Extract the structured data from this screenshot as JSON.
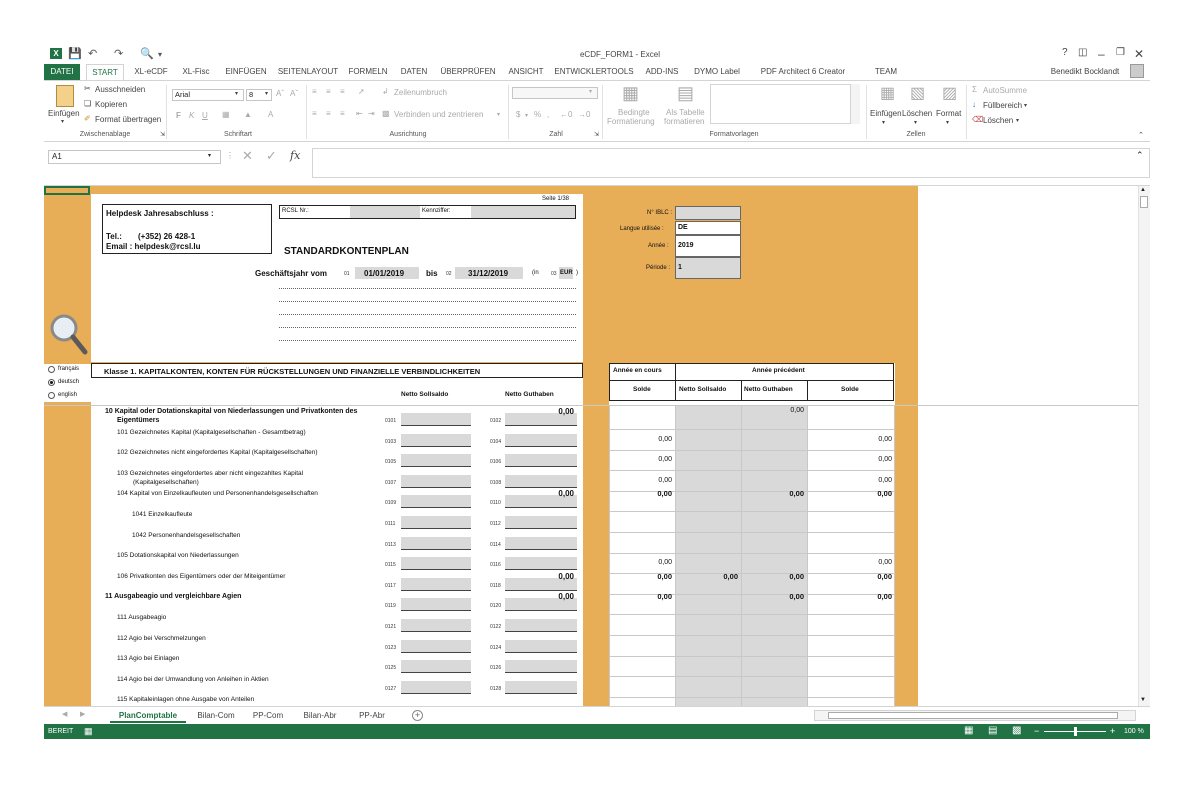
{
  "window": {
    "title": "eCDF_FORM1 - Excel",
    "user": "Benedikt Bocklandt",
    "help": "?",
    "colors": {
      "accent": "#217346",
      "sheet_bg": "#e8ad57"
    }
  },
  "ribbon_tabs": [
    "DATEI",
    "START",
    "XL-eCDF",
    "XL-Fisc",
    "EINFÜGEN",
    "SEITENLAYOUT",
    "FORMELN",
    "DATEN",
    "ÜBERPRÜFEN",
    "ANSICHT",
    "ENTWICKLERTOOLS",
    "ADD-INS",
    "DYMO Label",
    "PDF Architect 6 Creator",
    "TEAM"
  ],
  "ribbon": {
    "clipboard": {
      "paste": "Einfügen",
      "cut": "Ausschneiden",
      "copy": "Kopieren",
      "format_painter": "Format übertragen",
      "label": "Zwischenablage"
    },
    "font": {
      "name": "Arial",
      "size": "8",
      "bold": "F",
      "italic": "K",
      "underline": "U",
      "label": "Schriftart"
    },
    "alignment": {
      "wrap": "Zeilenumbruch",
      "merge": "Verbinden und zentrieren",
      "label": "Ausrichtung"
    },
    "number": {
      "currency": "$",
      "percent": "%",
      "label": "Zahl"
    },
    "styles": {
      "conditional_1": "Bedingte",
      "conditional_2": "Formatierung",
      "as_table_1": "Als Tabelle",
      "as_table_2": "formatieren",
      "label": "Formatvorlagen"
    },
    "cells": {
      "insert": "Einfügen",
      "delete": "Löschen",
      "format": "Format",
      "label": "Zellen"
    },
    "editing": {
      "autosum": "AutoSumme",
      "fill": "Füllbereich",
      "clear": "Löschen"
    }
  },
  "formula_bar": {
    "name_box": "A1",
    "fx": "fx"
  },
  "form": {
    "page": "Seite 1/38",
    "helpdesk_title": "Helpdesk Jahresabschluss :",
    "tel_label": "Tel.:",
    "tel": "(+352) 26 428-1",
    "email": "Email : helpdesk@rcsl.lu",
    "rcsl_label": "RCSL Nr.:",
    "kenn_label": "Kennziffer:",
    "title": "STANDARDKONTENPLAN",
    "fy_label": "Geschäftsjahr vom",
    "code_01": "01",
    "date_from": "01/01/2019",
    "bis": "bis",
    "code_02": "02",
    "date_to": "31/12/2019",
    "in": "(in",
    "code_03": "03",
    "currency": "EUR",
    "close_paren": ")",
    "iblc_label": "N° IBLC :",
    "lang_label": "Langue utilisée :",
    "lang": "DE",
    "year_label": "Année :",
    "year": "2019",
    "period_label": "Période :",
    "period": "1",
    "languages": [
      "français",
      "deutsch",
      "english"
    ],
    "selected_language": "deutsch",
    "class_title": "Klasse 1. KAPITALKONTEN, KONTEN FÜR RÜCKSTELLUNGEN UND FINANZIELLE VERBINDLICHKEITEN",
    "col_soll": "Netto Sollsaldo",
    "col_haben": "Netto Guthaben",
    "right_current": "Année en cours",
    "right_prev": "Année précédent",
    "right_solde": "Solde",
    "right_soll": "Netto Sollsaldo",
    "right_haben": "Netto Guthaben",
    "right_solde2": "Solde"
  },
  "rows": [
    {
      "label": "10 Kapital oder Dotationskapital von Niederlassungen und Privatkonten des",
      "label2": "Eigentümers",
      "bold": true,
      "c1": "0101",
      "c2": "0102",
      "v_haben": "0,00",
      "r_prev_haben": "0,00"
    },
    {
      "label": "101  Gezeichnetes Kapital (Kapitalgesellschaften - Gesamtbetrag)",
      "c1": "0103",
      "c2": "0104",
      "r_solde": "0,00",
      "r_solde2": "0,00"
    },
    {
      "label": "102  Gezeichnetes nicht eingefordertes Kapital (Kapitalgesellschaften)",
      "c1": "0105",
      "c2": "0106",
      "r_solde": "0,00",
      "r_solde2": "0,00"
    },
    {
      "label": "103  Gezeichnetes eingefordertes aber nicht eingezahltes Kapital",
      "label2": "(Kapitalgesellschaften)",
      "c1": "0107",
      "c2": "0108",
      "r_solde": "0,00",
      "r_solde2": "0,00"
    },
    {
      "label": "104  Kapital von Einzelkaufleuten und Personenhandelsgesellschaften",
      "c1": "0109",
      "c2": "0110",
      "v_haben": "0,00",
      "r_solde": "0,00",
      "r_prev_haben": "0,00",
      "r_solde2": "0,00",
      "boldvals": true
    },
    {
      "label": "1041  Einzelkaufleute",
      "indent": 2,
      "c1": "0111",
      "c2": "0112"
    },
    {
      "label": "1042  Personenhandelsgesellschaften",
      "indent": 2,
      "c1": "0113",
      "c2": "0114"
    },
    {
      "label": "105  Dotationskapital von Niederlassungen",
      "c1": "0115",
      "c2": "0116",
      "r_solde": "0,00",
      "r_solde2": "0,00"
    },
    {
      "label": "106  Privatkonten des Eigentümers oder der Miteigentümer",
      "c1": "0117",
      "c2": "0118",
      "v_haben": "0,00",
      "r_solde": "0,00",
      "r_prev_soll": "0,00",
      "r_prev_haben": "0,00",
      "r_solde2": "0,00",
      "boldvals": true
    },
    {
      "label": "11 Ausgabeagio und vergleichbare Agien",
      "bold": true,
      "c1": "0119",
      "c2": "0120",
      "v_haben": "0,00",
      "r_solde": "0,00",
      "r_prev_haben": "0,00",
      "r_solde2": "0,00",
      "boldvals": true
    },
    {
      "label": "111  Ausgabeagio",
      "c1": "0121",
      "c2": "0122"
    },
    {
      "label": "112  Agio bei Verschmelzungen",
      "c1": "0123",
      "c2": "0124"
    },
    {
      "label": "113  Agio bei Einlagen",
      "c1": "0125",
      "c2": "0126"
    },
    {
      "label": "114  Agio bei der Umwandlung von Anleihen in Aktien",
      "c1": "0127",
      "c2": "0128"
    },
    {
      "label": "115  Kapitaleinlagen ohne Ausgabe von Anteilen",
      "c1": "",
      "c2": ""
    }
  ],
  "sheet_tabs": [
    "PlanComptable",
    "Bilan-Com",
    "PP-Com",
    "Bilan-Abr",
    "PP-Abr"
  ],
  "active_sheet": "PlanComptable",
  "status": {
    "ready": "BEREIT",
    "zoom": "100 %",
    "minus": "−",
    "plus": "+"
  }
}
